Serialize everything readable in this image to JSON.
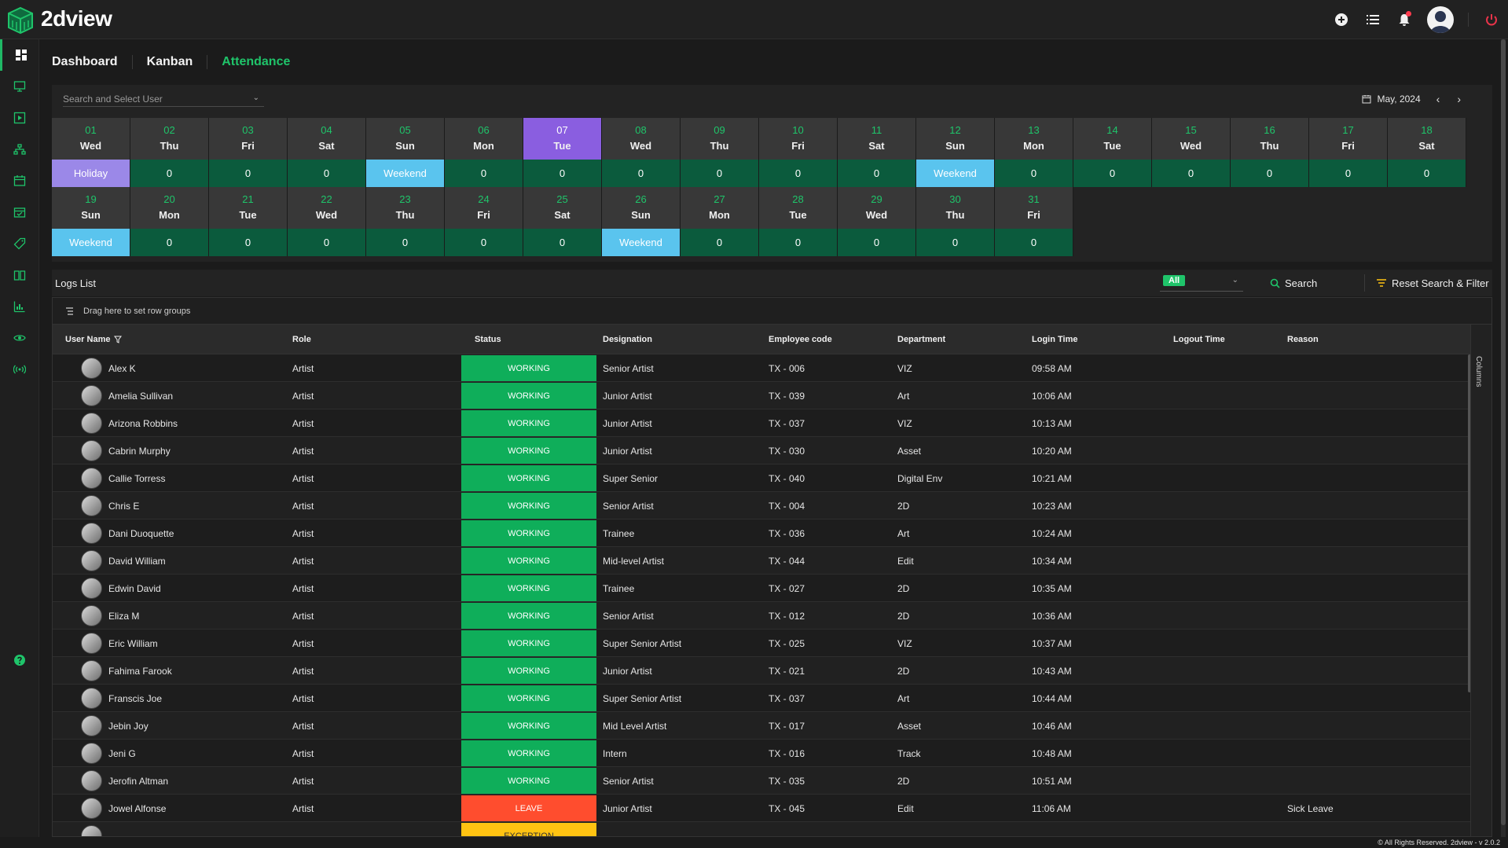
{
  "app": {
    "brand": "2dview",
    "footer": "© All Rights Reserved. 2dview - v 2.0.2"
  },
  "nav": {
    "tabs": [
      "Dashboard",
      "Kanban",
      "Attendance"
    ]
  },
  "search_user": {
    "placeholder": "Search and Select User"
  },
  "calendar": {
    "month_label": "May, 2024",
    "days": [
      {
        "num": "01",
        "wd": "Wed",
        "val": "Holiday",
        "type": "holiday"
      },
      {
        "num": "02",
        "wd": "Thu",
        "val": "0",
        "type": "normal"
      },
      {
        "num": "03",
        "wd": "Fri",
        "val": "0",
        "type": "normal"
      },
      {
        "num": "04",
        "wd": "Sat",
        "val": "0",
        "type": "normal"
      },
      {
        "num": "05",
        "wd": "Sun",
        "val": "Weekend",
        "type": "weekend"
      },
      {
        "num": "06",
        "wd": "Mon",
        "val": "0",
        "type": "normal"
      },
      {
        "num": "07",
        "wd": "Tue",
        "val": "0",
        "type": "today"
      },
      {
        "num": "08",
        "wd": "Wed",
        "val": "0",
        "type": "normal"
      },
      {
        "num": "09",
        "wd": "Thu",
        "val": "0",
        "type": "normal"
      },
      {
        "num": "10",
        "wd": "Fri",
        "val": "0",
        "type": "normal"
      },
      {
        "num": "11",
        "wd": "Sat",
        "val": "0",
        "type": "normal"
      },
      {
        "num": "12",
        "wd": "Sun",
        "val": "Weekend",
        "type": "weekend"
      },
      {
        "num": "13",
        "wd": "Mon",
        "val": "0",
        "type": "normal"
      },
      {
        "num": "14",
        "wd": "Tue",
        "val": "0",
        "type": "normal"
      },
      {
        "num": "15",
        "wd": "Wed",
        "val": "0",
        "type": "normal"
      },
      {
        "num": "16",
        "wd": "Thu",
        "val": "0",
        "type": "normal"
      },
      {
        "num": "17",
        "wd": "Fri",
        "val": "0",
        "type": "normal"
      },
      {
        "num": "18",
        "wd": "Sat",
        "val": "0",
        "type": "normal"
      },
      {
        "num": "19",
        "wd": "Sun",
        "val": "Weekend",
        "type": "weekend"
      },
      {
        "num": "20",
        "wd": "Mon",
        "val": "0",
        "type": "normal"
      },
      {
        "num": "21",
        "wd": "Tue",
        "val": "0",
        "type": "normal"
      },
      {
        "num": "22",
        "wd": "Wed",
        "val": "0",
        "type": "normal"
      },
      {
        "num": "23",
        "wd": "Thu",
        "val": "0",
        "type": "normal"
      },
      {
        "num": "24",
        "wd": "Fri",
        "val": "0",
        "type": "normal"
      },
      {
        "num": "25",
        "wd": "Sat",
        "val": "0",
        "type": "normal"
      },
      {
        "num": "26",
        "wd": "Sun",
        "val": "Weekend",
        "type": "weekend"
      },
      {
        "num": "27",
        "wd": "Mon",
        "val": "0",
        "type": "normal"
      },
      {
        "num": "28",
        "wd": "Tue",
        "val": "0",
        "type": "normal"
      },
      {
        "num": "29",
        "wd": "Wed",
        "val": "0",
        "type": "normal"
      },
      {
        "num": "30",
        "wd": "Thu",
        "val": "0",
        "type": "normal"
      },
      {
        "num": "31",
        "wd": "Fri",
        "val": "0",
        "type": "normal"
      }
    ]
  },
  "logs": {
    "title": "Logs List",
    "filter_value": "All",
    "search_label": "Search",
    "reset_label": "Reset Search & Filter",
    "group_hint": "Drag here to set row groups",
    "columns_label": "Columns",
    "headers": [
      "User Name",
      "Role",
      "Status",
      "Designation",
      "Employee code",
      "Department",
      "Login Time",
      "Logout Time",
      "Reason"
    ],
    "rows": [
      {
        "name": "Alex K",
        "role": "Artist",
        "status": "WORKING",
        "designation": "Senior Artist",
        "code": "TX - 006",
        "dept": "VIZ",
        "login": "09:58 AM",
        "logout": "",
        "reason": ""
      },
      {
        "name": "Amelia Sullivan",
        "role": "Artist",
        "status": "WORKING",
        "designation": "Junior Artist",
        "code": "TX - 039",
        "dept": "Art",
        "login": "10:06 AM",
        "logout": "",
        "reason": ""
      },
      {
        "name": "Arizona Robbins",
        "role": "Artist",
        "status": "WORKING",
        "designation": "Junior Artist",
        "code": "TX - 037",
        "dept": "VIZ",
        "login": "10:13 AM",
        "logout": "",
        "reason": ""
      },
      {
        "name": "Cabrin Murphy",
        "role": "Artist",
        "status": "WORKING",
        "designation": "Junior Artist",
        "code": "TX - 030",
        "dept": "Asset",
        "login": "10:20 AM",
        "logout": "",
        "reason": ""
      },
      {
        "name": "Callie Torress",
        "role": "Artist",
        "status": "WORKING",
        "designation": "Super Senior",
        "code": "TX - 040",
        "dept": "Digital Env",
        "login": "10:21 AM",
        "logout": "",
        "reason": ""
      },
      {
        "name": "Chris E",
        "role": "Artist",
        "status": "WORKING",
        "designation": "Senior Artist",
        "code": "TX - 004",
        "dept": "2D",
        "login": "10:23 AM",
        "logout": "",
        "reason": ""
      },
      {
        "name": "Dani Duoquette",
        "role": "Artist",
        "status": "WORKING",
        "designation": "Trainee",
        "code": "TX - 036",
        "dept": "Art",
        "login": "10:24 AM",
        "logout": "",
        "reason": ""
      },
      {
        "name": "David William",
        "role": "Artist",
        "status": "WORKING",
        "designation": "Mid-level Artist",
        "code": "TX - 044",
        "dept": "Edit",
        "login": "10:34 AM",
        "logout": "",
        "reason": ""
      },
      {
        "name": "Edwin David",
        "role": "Artist",
        "status": "WORKING",
        "designation": "Trainee",
        "code": "TX - 027",
        "dept": "2D",
        "login": "10:35 AM",
        "logout": "",
        "reason": ""
      },
      {
        "name": "Eliza M",
        "role": "Artist",
        "status": "WORKING",
        "designation": "Senior Artist",
        "code": "TX - 012",
        "dept": "2D",
        "login": "10:36 AM",
        "logout": "",
        "reason": ""
      },
      {
        "name": "Eric William",
        "role": "Artist",
        "status": "WORKING",
        "designation": "Super Senior Artist",
        "code": "TX - 025",
        "dept": "VIZ",
        "login": "10:37 AM",
        "logout": "",
        "reason": ""
      },
      {
        "name": "Fahima Farook",
        "role": "Artist",
        "status": "WORKING",
        "designation": "Junior Artist",
        "code": "TX - 021",
        "dept": "2D",
        "login": "10:43 AM",
        "logout": "",
        "reason": ""
      },
      {
        "name": "Franscis Joe",
        "role": "Artist",
        "status": "WORKING",
        "designation": "Super Senior Artist",
        "code": "TX - 037",
        "dept": "Art",
        "login": "10:44 AM",
        "logout": "",
        "reason": ""
      },
      {
        "name": "Jebin Joy",
        "role": "Artist",
        "status": "WORKING",
        "designation": "Mid Level Artist",
        "code": "TX - 017",
        "dept": "Asset",
        "login": "10:46 AM",
        "logout": "",
        "reason": ""
      },
      {
        "name": "Jeni G",
        "role": "Artist",
        "status": "WORKING",
        "designation": "Intern",
        "code": "TX - 016",
        "dept": "Track",
        "login": "10:48 AM",
        "logout": "",
        "reason": ""
      },
      {
        "name": "Jerofin Altman",
        "role": "Artist",
        "status": "WORKING",
        "designation": "Senior Artist",
        "code": "TX - 035",
        "dept": "2D",
        "login": "10:51 AM",
        "logout": "",
        "reason": ""
      },
      {
        "name": "Jowel Alfonse",
        "role": "Artist",
        "status": "LEAVE",
        "designation": "Junior Artist",
        "code": "TX - 045",
        "dept": "Edit",
        "login": "11:06 AM",
        "logout": "",
        "reason": "Sick Leave"
      },
      {
        "name": "",
        "role": "",
        "status": "EXCEPTION",
        "designation": "",
        "code": "",
        "dept": "",
        "login": "",
        "logout": "",
        "reason": ""
      }
    ]
  },
  "colors": {
    "accent": "#1fc46a",
    "today": "#8a5ee0",
    "weekend": "#5ac4ee",
    "holiday": "#9b88e8",
    "working": "#0fae5a",
    "leave": "#ff4d2e",
    "exception": "#ffc312"
  }
}
